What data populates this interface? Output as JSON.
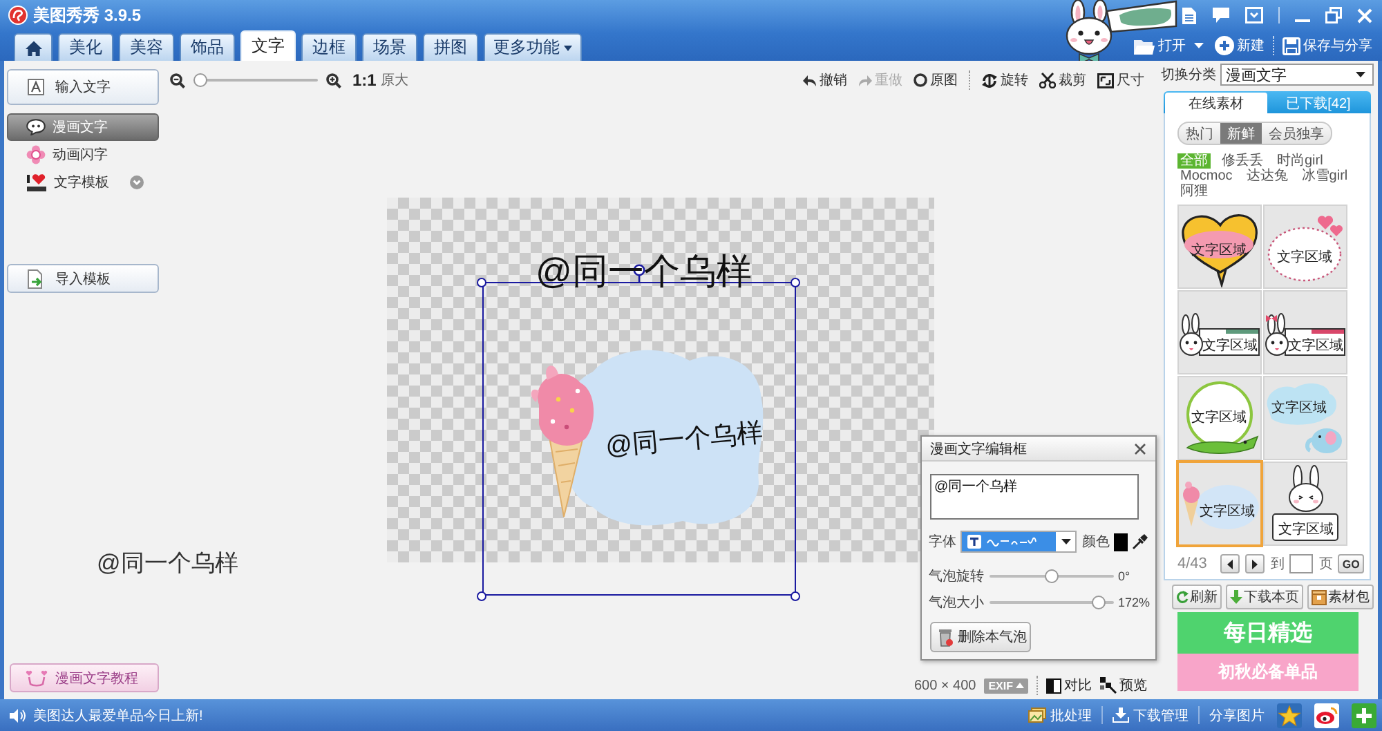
{
  "window": {
    "title": "美图秀秀 3.9.5"
  },
  "tabs": [
    {
      "kind": "home",
      "selected": false
    },
    {
      "kind": "text",
      "label": "美化",
      "selected": false
    },
    {
      "kind": "text",
      "label": "美容",
      "selected": false
    },
    {
      "kind": "text",
      "label": "饰品",
      "selected": false
    },
    {
      "kind": "text",
      "label": "文字",
      "selected": true
    },
    {
      "kind": "text",
      "label": "边框",
      "selected": false
    },
    {
      "kind": "text",
      "label": "场景",
      "selected": false
    },
    {
      "kind": "text",
      "label": "拼图",
      "selected": false
    },
    {
      "kind": "menu",
      "label": "更多功能",
      "selected": false
    }
  ],
  "header_actions": [
    {
      "label": "打开",
      "dropdown": true
    },
    {
      "label": "新建",
      "dropdown": false
    },
    {
      "label": "保存与分享",
      "dropdown": false
    }
  ],
  "left_panel": {
    "input_button": "输入文字",
    "items": [
      {
        "label": "漫画文字",
        "selected": true,
        "submenu": false
      },
      {
        "label": "动画闪字",
        "selected": false,
        "submenu": false
      },
      {
        "label": "文字模板",
        "selected": false,
        "submenu": true
      }
    ],
    "import_button": "导入模板",
    "tutorial_button": "漫画文字教程"
  },
  "toolbar": {
    "zoom": {
      "level": 0.05
    },
    "zoom_button": "**1:1** 原大",
    "history": [
      {
        "label": "撤销",
        "disabled": false
      },
      {
        "label": "重做",
        "disabled": true
      },
      {
        "label": "原图",
        "disabled": false
      }
    ],
    "edit": [
      {
        "label": "旋转"
      },
      {
        "label": "裁剪"
      },
      {
        "label": "尺寸"
      }
    ]
  },
  "canvas": {
    "headline": "@同一个乌样",
    "bubble_text": "@同一个乌样"
  },
  "workspace_text": "@同一个乌样",
  "canvas_info": {
    "size": "600 × 400",
    "exif": "EXIF",
    "compare": "对比",
    "preview": "预览"
  },
  "editor": {
    "title": "漫画文字编辑框",
    "text": "@同一个乌样",
    "font_label": "字体",
    "color_label": "颜色",
    "color": "#000000",
    "sliders": [
      {
        "label": "气泡旋转",
        "level": 0.5,
        "reading": "0°"
      },
      {
        "label": "气泡大小",
        "level": 0.88,
        "reading": "172%"
      }
    ],
    "delete_button": "删除本气泡"
  },
  "right_panel": {
    "category_label": "切换分类",
    "category": "漫画文字",
    "source_tabs": [
      {
        "label": "在线素材",
        "selected": true
      },
      {
        "label": "已下载[42]",
        "selected": false
      }
    ],
    "filters": [
      {
        "label": "热门",
        "selected": false
      },
      {
        "label": "新鲜",
        "selected": true
      },
      {
        "label": "会员独享",
        "selected": false
      }
    ],
    "tags": [
      {
        "label": "全部",
        "selected": true
      },
      {
        "label": "修丢丢",
        "selected": false
      },
      {
        "label": "时尚girl",
        "selected": false
      },
      {
        "label": "Mocmoc",
        "selected": false
      },
      {
        "label": "达达兔",
        "selected": false
      },
      {
        "label": "冰雪girl",
        "selected": false
      },
      {
        "label": "阿狸",
        "selected": false
      }
    ],
    "stickers": [
      {
        "caption": "文字区域",
        "selected": false
      },
      {
        "caption": "文字区域",
        "selected": false
      },
      {
        "caption": "文字区域",
        "selected": false
      },
      {
        "caption": "文字区域",
        "selected": false
      },
      {
        "caption": "文字区域",
        "selected": false
      },
      {
        "caption": "文字区域",
        "selected": false
      },
      {
        "caption": "文字区域",
        "selected": true
      },
      {
        "caption": "文字区域",
        "selected": false
      }
    ],
    "pagination": {
      "page": "4/43",
      "goto": "到",
      "page_unit": "页",
      "go": "GO"
    },
    "buttons": [
      {
        "label": "刷新"
      },
      {
        "label": "下载本页"
      },
      {
        "label": "素材包"
      }
    ],
    "promos": [
      {
        "text": "每日精选",
        "color": "#4fd36e"
      },
      {
        "text": "初秋必备单品",
        "color": "#f8a5c9"
      }
    ]
  },
  "status_bar": {
    "message": "美图达人最爱单品今日上新!",
    "actions": [
      {
        "label": "批处理"
      },
      {
        "label": "下载管理"
      },
      {
        "label": "分享图片"
      }
    ]
  }
}
